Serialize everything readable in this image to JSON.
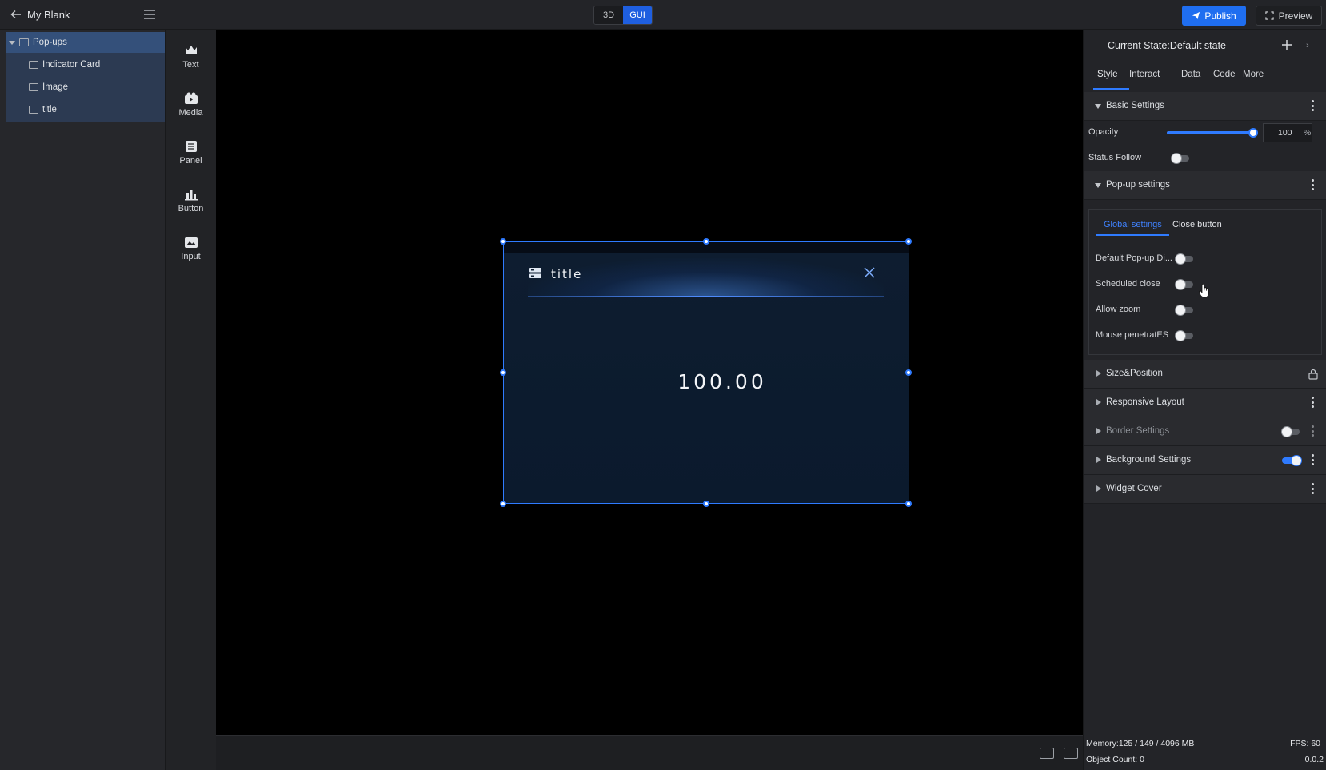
{
  "topbar": {
    "project_title": "My Blank",
    "mode_3d": "3D",
    "mode_gui": "GUI",
    "publish_label": "Publish",
    "preview_label": "Preview"
  },
  "layers": {
    "root": "Pop-ups",
    "children": [
      "Indicator Card",
      "Image",
      "title"
    ]
  },
  "toolbox": {
    "items": [
      "Text",
      "Media",
      "Panel",
      "Button",
      "Input"
    ]
  },
  "popup": {
    "title": "title",
    "value": "100.00"
  },
  "props": {
    "state_label": "Current State:Default state",
    "tabs": [
      "Style",
      "Interact",
      "Data",
      "Code",
      "More"
    ],
    "basic_settings": "Basic Settings",
    "opacity_label": "Opacity",
    "opacity_value": "100",
    "opacity_unit": "%",
    "status_follow_label": "Status Follow",
    "popup_settings": "Pop-up settings",
    "subtabs": [
      "Global settings",
      "Close button"
    ],
    "popup_options": [
      "Default Pop-up Di...",
      "Scheduled close",
      "Allow zoom",
      "Mouse penetratES"
    ],
    "size_position": "Size&Position",
    "responsive_layout": "Responsive Layout",
    "border_settings": "Border Settings",
    "background_settings": "Background Settings",
    "widget_cover": "Widget Cover"
  },
  "footer": {
    "memory": "Memory:125 / 149 / 4096 MB",
    "fps": "FPS: 60",
    "object_count": "Object Count: 0",
    "version": "0.0.2"
  },
  "colors": {
    "accent": "#2f7bff",
    "canvas": "#000000",
    "panel": "#232428"
  }
}
